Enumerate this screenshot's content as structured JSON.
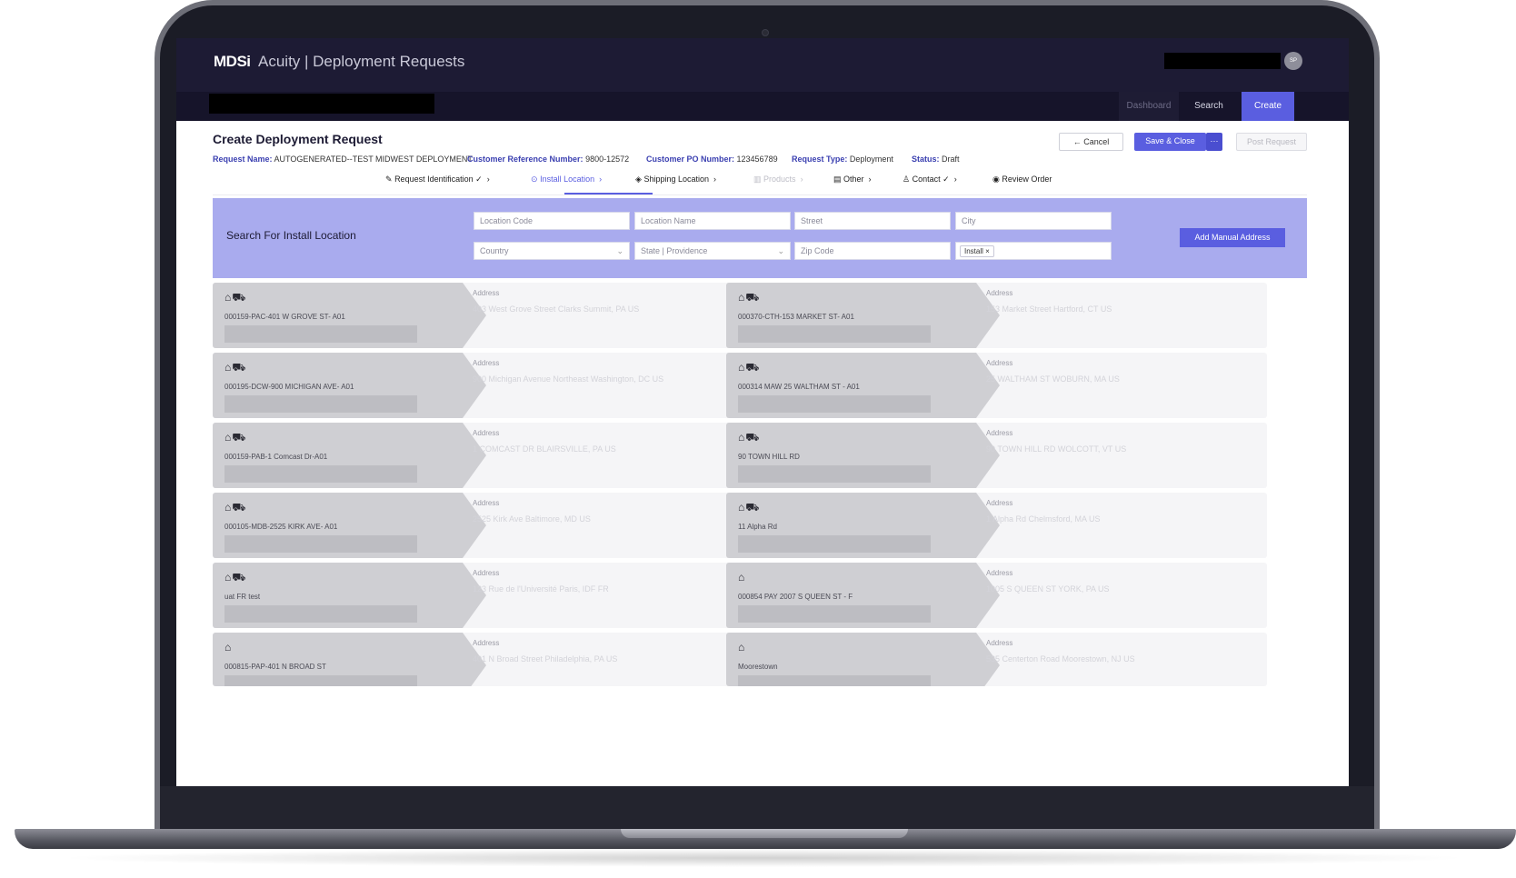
{
  "app": {
    "logo": "MDSi",
    "title": "Acuity | Deployment Requests",
    "avatar_initials": "SP"
  },
  "nav": {
    "dashboard": "Dashboard",
    "search": "Search",
    "create": "Create"
  },
  "page": {
    "title": "Create Deployment Request",
    "meta": {
      "request_name_label": "Request Name:",
      "request_name": "AUTOGENERATED--TEST MIDWEST DEPLOYMENT",
      "customer_ref_label": "Customer Reference Number:",
      "customer_ref": "9800-12572",
      "customer_po_label": "Customer PO Number:",
      "customer_po": "123456789",
      "request_type_label": "Request Type:",
      "request_type": "Deployment",
      "status_label": "Status:",
      "status": "Draft"
    },
    "buttons": {
      "cancel": "Cancel",
      "save_close": "Save & Close",
      "more": "···",
      "post_request": "Post Request"
    }
  },
  "steps": [
    {
      "label": "Request Identification",
      "icon": "edit-icon",
      "done": true
    },
    {
      "label": "Install Location",
      "icon": "location-pin-icon",
      "active": true
    },
    {
      "label": "Shipping Location",
      "icon": "shipping-icon"
    },
    {
      "label": "Products",
      "icon": "products-icon",
      "disabled": true
    },
    {
      "label": "Other",
      "icon": "document-icon"
    },
    {
      "label": "Contact",
      "icon": "person-icon",
      "done": true
    },
    {
      "label": "Review Order",
      "icon": "eye-icon"
    }
  ],
  "search_panel": {
    "title": "Search For Install Location",
    "location_code_placeholder": "Location Code",
    "location_name_placeholder": "Location Name",
    "street_placeholder": "Street",
    "city_placeholder": "City",
    "country_placeholder": "Country",
    "state_placeholder": "State | Providence",
    "zip_placeholder": "Zip Code",
    "type_chip": "Install",
    "add_manual": "Add Manual Address"
  },
  "locations": [
    {
      "code": "000159-PAC-401 W GROVE ST- A01",
      "address_label": "Address",
      "address": "403 West Grove Street Clarks Summit, PA US",
      "icons": "warehouse-truck"
    },
    {
      "code": "000370-CTH-153 MARKET ST- A01",
      "address_label": "Address",
      "address": "153 Market Street Hartford, CT US",
      "icons": "warehouse-truck"
    },
    {
      "code": "000195-DCW-900 MICHIGAN AVE- A01",
      "address_label": "Address",
      "address": "900 Michigan Avenue Northeast Washington, DC US",
      "icons": "warehouse-truck"
    },
    {
      "code": "000314 MAW 25 WALTHAM ST - A01",
      "address_label": "Address",
      "address": "25 WALTHAM ST WOBURN, MA US",
      "icons": "warehouse-truck"
    },
    {
      "code": "000159-PAB-1 Comcast Dr-A01",
      "address_label": "Address",
      "address": "1 COMCAST DR BLAIRSVILLE, PA US",
      "icons": "warehouse-truck"
    },
    {
      "code": "90 TOWN HILL RD",
      "address_label": "Address",
      "address": "90 TOWN HILL RD WOLCOTT, VT US",
      "icons": "warehouse-truck"
    },
    {
      "code": "000105-MDB-2525 KIRK AVE- A01",
      "address_label": "Address",
      "address": "2525 Kirk Ave Baltimore, MD US",
      "icons": "warehouse-truck"
    },
    {
      "code": "11 Alpha Rd",
      "address_label": "Address",
      "address": "1 Alpha Rd Chelmsford, MA US",
      "icons": "warehouse-truck"
    },
    {
      "code": "uat FR test",
      "address_label": "Address",
      "address": "123 Rue de l'Université Paris, IDF FR",
      "icons": "warehouse-truck"
    },
    {
      "code": "000854 PAY 2007 S QUEEN ST - F",
      "address_label": "Address",
      "address": "1005 S QUEEN ST YORK, PA US",
      "icons": "warehouse"
    },
    {
      "code": "000815-PAP-401 N BROAD ST",
      "address_label": "Address",
      "address": "401 N Broad Street Philadelphia, PA US",
      "icons": "warehouse"
    },
    {
      "code": "Moorestown",
      "address_label": "Address",
      "address": "535 Centerton Road Moorestown, NJ US",
      "icons": "warehouse"
    }
  ]
}
